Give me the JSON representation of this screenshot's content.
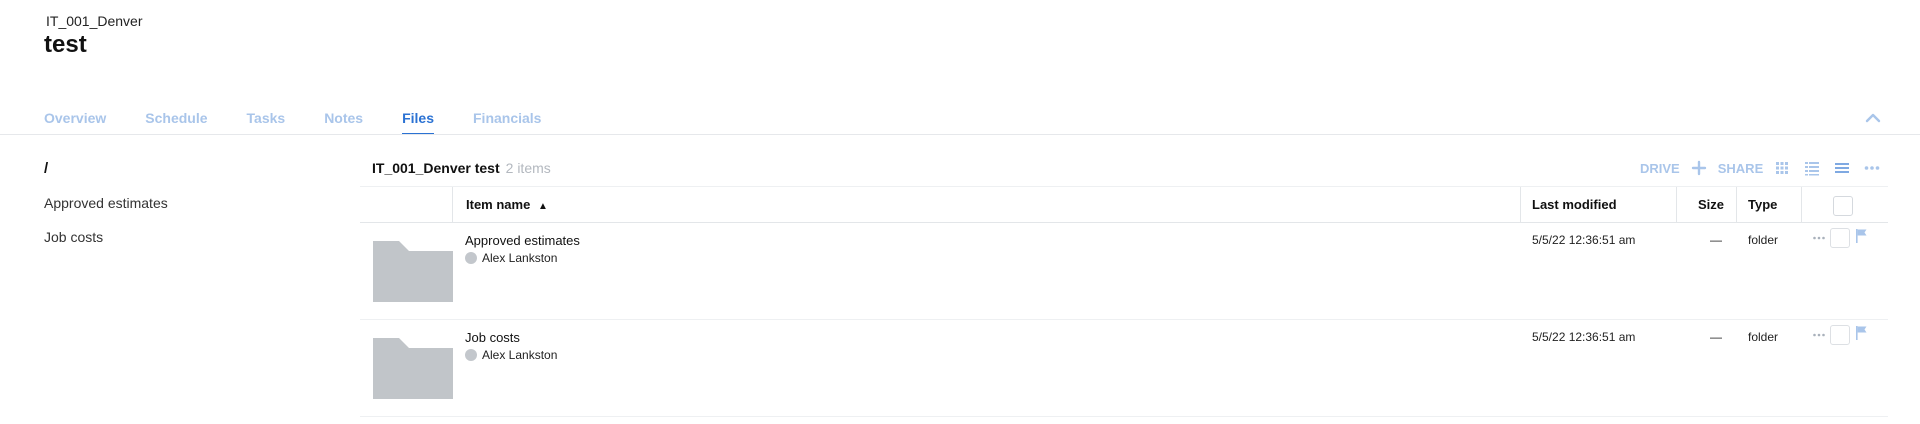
{
  "project": {
    "code": "IT_001_Denver",
    "title": "test"
  },
  "tabs": [
    {
      "label": "Overview"
    },
    {
      "label": "Schedule"
    },
    {
      "label": "Tasks"
    },
    {
      "label": "Notes"
    },
    {
      "label": "Files",
      "active": true
    },
    {
      "label": "Financials"
    }
  ],
  "tree": {
    "root": "/",
    "items": [
      "Approved estimates",
      "Job costs"
    ]
  },
  "listing": {
    "folder_name": "IT_001_Denver test",
    "count": "2 items"
  },
  "toolbar": {
    "drive_label": "DRIVE",
    "share_label": "SHARE",
    "icons": [
      "plus-icon",
      "grid-view-icon",
      "detail-list-icon",
      "compact-list-icon",
      "more-icon"
    ]
  },
  "columns": {
    "name": "Item name",
    "sort_indicator": "▲",
    "modified": "Last modified",
    "size": "Size",
    "type": "Type"
  },
  "rows": [
    {
      "name": "Approved estimates",
      "owner": "Alex Lankston",
      "modified": "5/5/22 12:36:51 am",
      "size": "—",
      "type": "folder"
    },
    {
      "name": "Job costs",
      "owner": "Alex Lankston",
      "modified": "5/5/22 12:36:51 am",
      "size": "—",
      "type": "folder"
    }
  ],
  "colors": {
    "accent": "#2b72d3",
    "tab_inactive": "#a9c5ea",
    "folder_thumb": "#c1c5c9"
  }
}
